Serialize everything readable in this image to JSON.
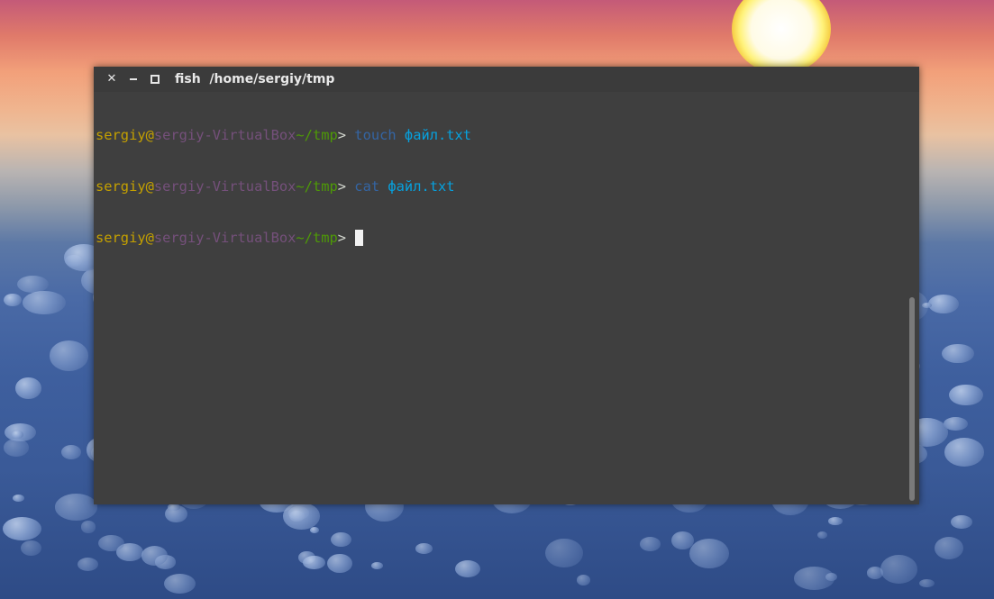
{
  "window": {
    "title_app": "fish",
    "title_path": "/home/sergiy/tmp",
    "close_glyph": "✕"
  },
  "terminal": {
    "lines": [
      {
        "user": "sergiy@",
        "host": "sergiy-VirtualBox",
        "path": "~/tmp",
        "gt": "> ",
        "command": "touch",
        "argument": "файл.txt"
      },
      {
        "user": "sergiy@",
        "host": "sergiy-VirtualBox",
        "path": "~/tmp",
        "gt": "> ",
        "command": "cat",
        "argument": "файл.txt"
      },
      {
        "user": "sergiy@",
        "host": "sergiy-VirtualBox",
        "path": "~/tmp",
        "gt": ">"
      }
    ]
  },
  "colors": {
    "terminal_bg": "#3f3f3f",
    "user": "#c4a000",
    "host": "#75507b",
    "path": "#4e9a06",
    "command": "#3465a4",
    "argument": "#06a1de"
  },
  "icons": {
    "close": "close-icon",
    "minimize": "minimize-icon",
    "maximize": "maximize-icon"
  }
}
